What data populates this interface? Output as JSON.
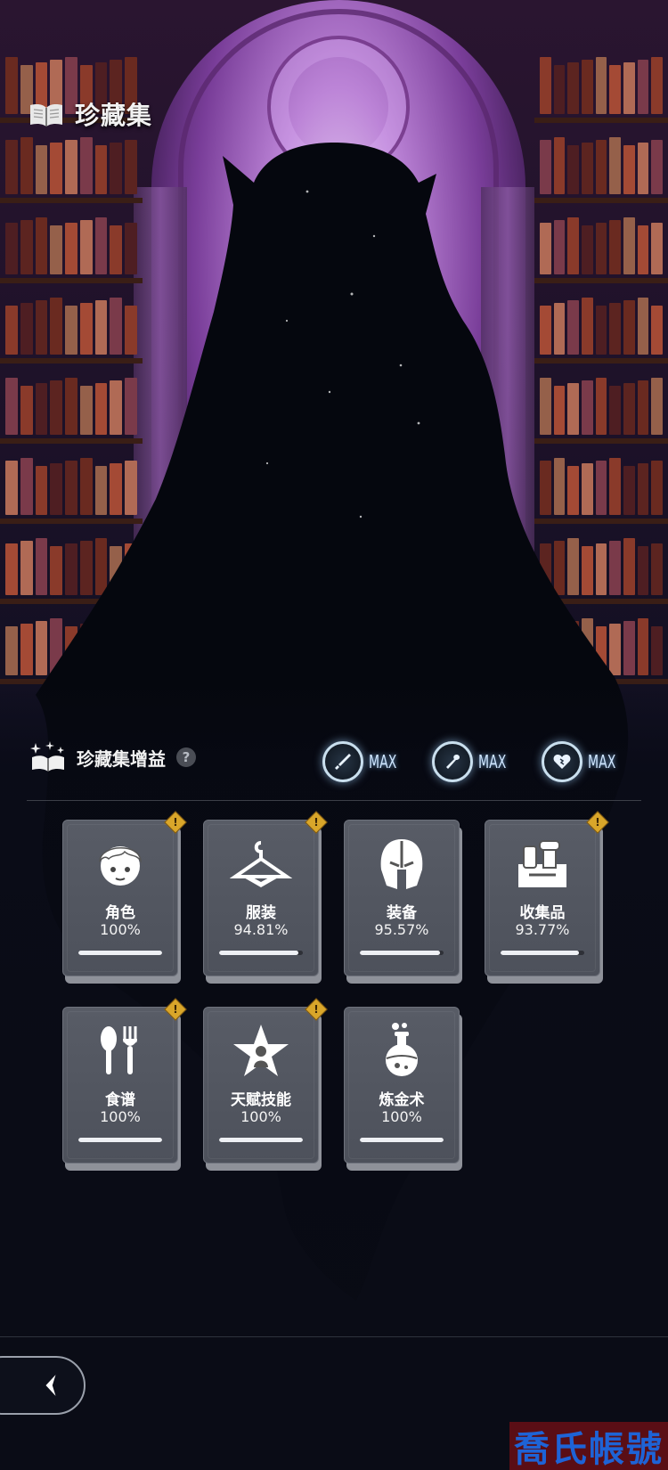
{
  "header": {
    "title": "珍藏集",
    "icon": "open-book-icon"
  },
  "bonus": {
    "title": "珍藏集增益",
    "help": "?",
    "stats": [
      {
        "icon": "sword-icon",
        "value": "MAX"
      },
      {
        "icon": "wand-icon",
        "value": "MAX"
      },
      {
        "icon": "heart-icon",
        "value": "MAX"
      }
    ]
  },
  "cards": [
    {
      "label": "角色",
      "value": "100%",
      "progress": 1.0,
      "alert": true,
      "icon": "character-face-icon"
    },
    {
      "label": "服装",
      "value": "94.81%",
      "progress": 0.9481,
      "alert": true,
      "icon": "hanger-icon"
    },
    {
      "label": "装备",
      "value": "95.57%",
      "progress": 0.9557,
      "alert": false,
      "icon": "helmet-icon"
    },
    {
      "label": "收集品",
      "value": "93.77%",
      "progress": 0.9377,
      "alert": true,
      "icon": "collectibles-icon"
    },
    {
      "label": "食谱",
      "value": "100%",
      "progress": 1.0,
      "alert": true,
      "icon": "spoon-fork-icon"
    },
    {
      "label": "天赋技能",
      "value": "100%",
      "progress": 1.0,
      "alert": true,
      "icon": "talent-star-icon"
    },
    {
      "label": "炼金术",
      "value": "100%",
      "progress": 1.0,
      "alert": false,
      "icon": "potion-flask-icon"
    }
  ],
  "alert_glyph": "!",
  "watermark": "喬氏帳號",
  "colors": {
    "alert": "#d9a62a",
    "card": "#555963",
    "glow": "#cfe6ff",
    "watermark_bg": "#5a0e15",
    "watermark_text": "#1e63d6"
  }
}
